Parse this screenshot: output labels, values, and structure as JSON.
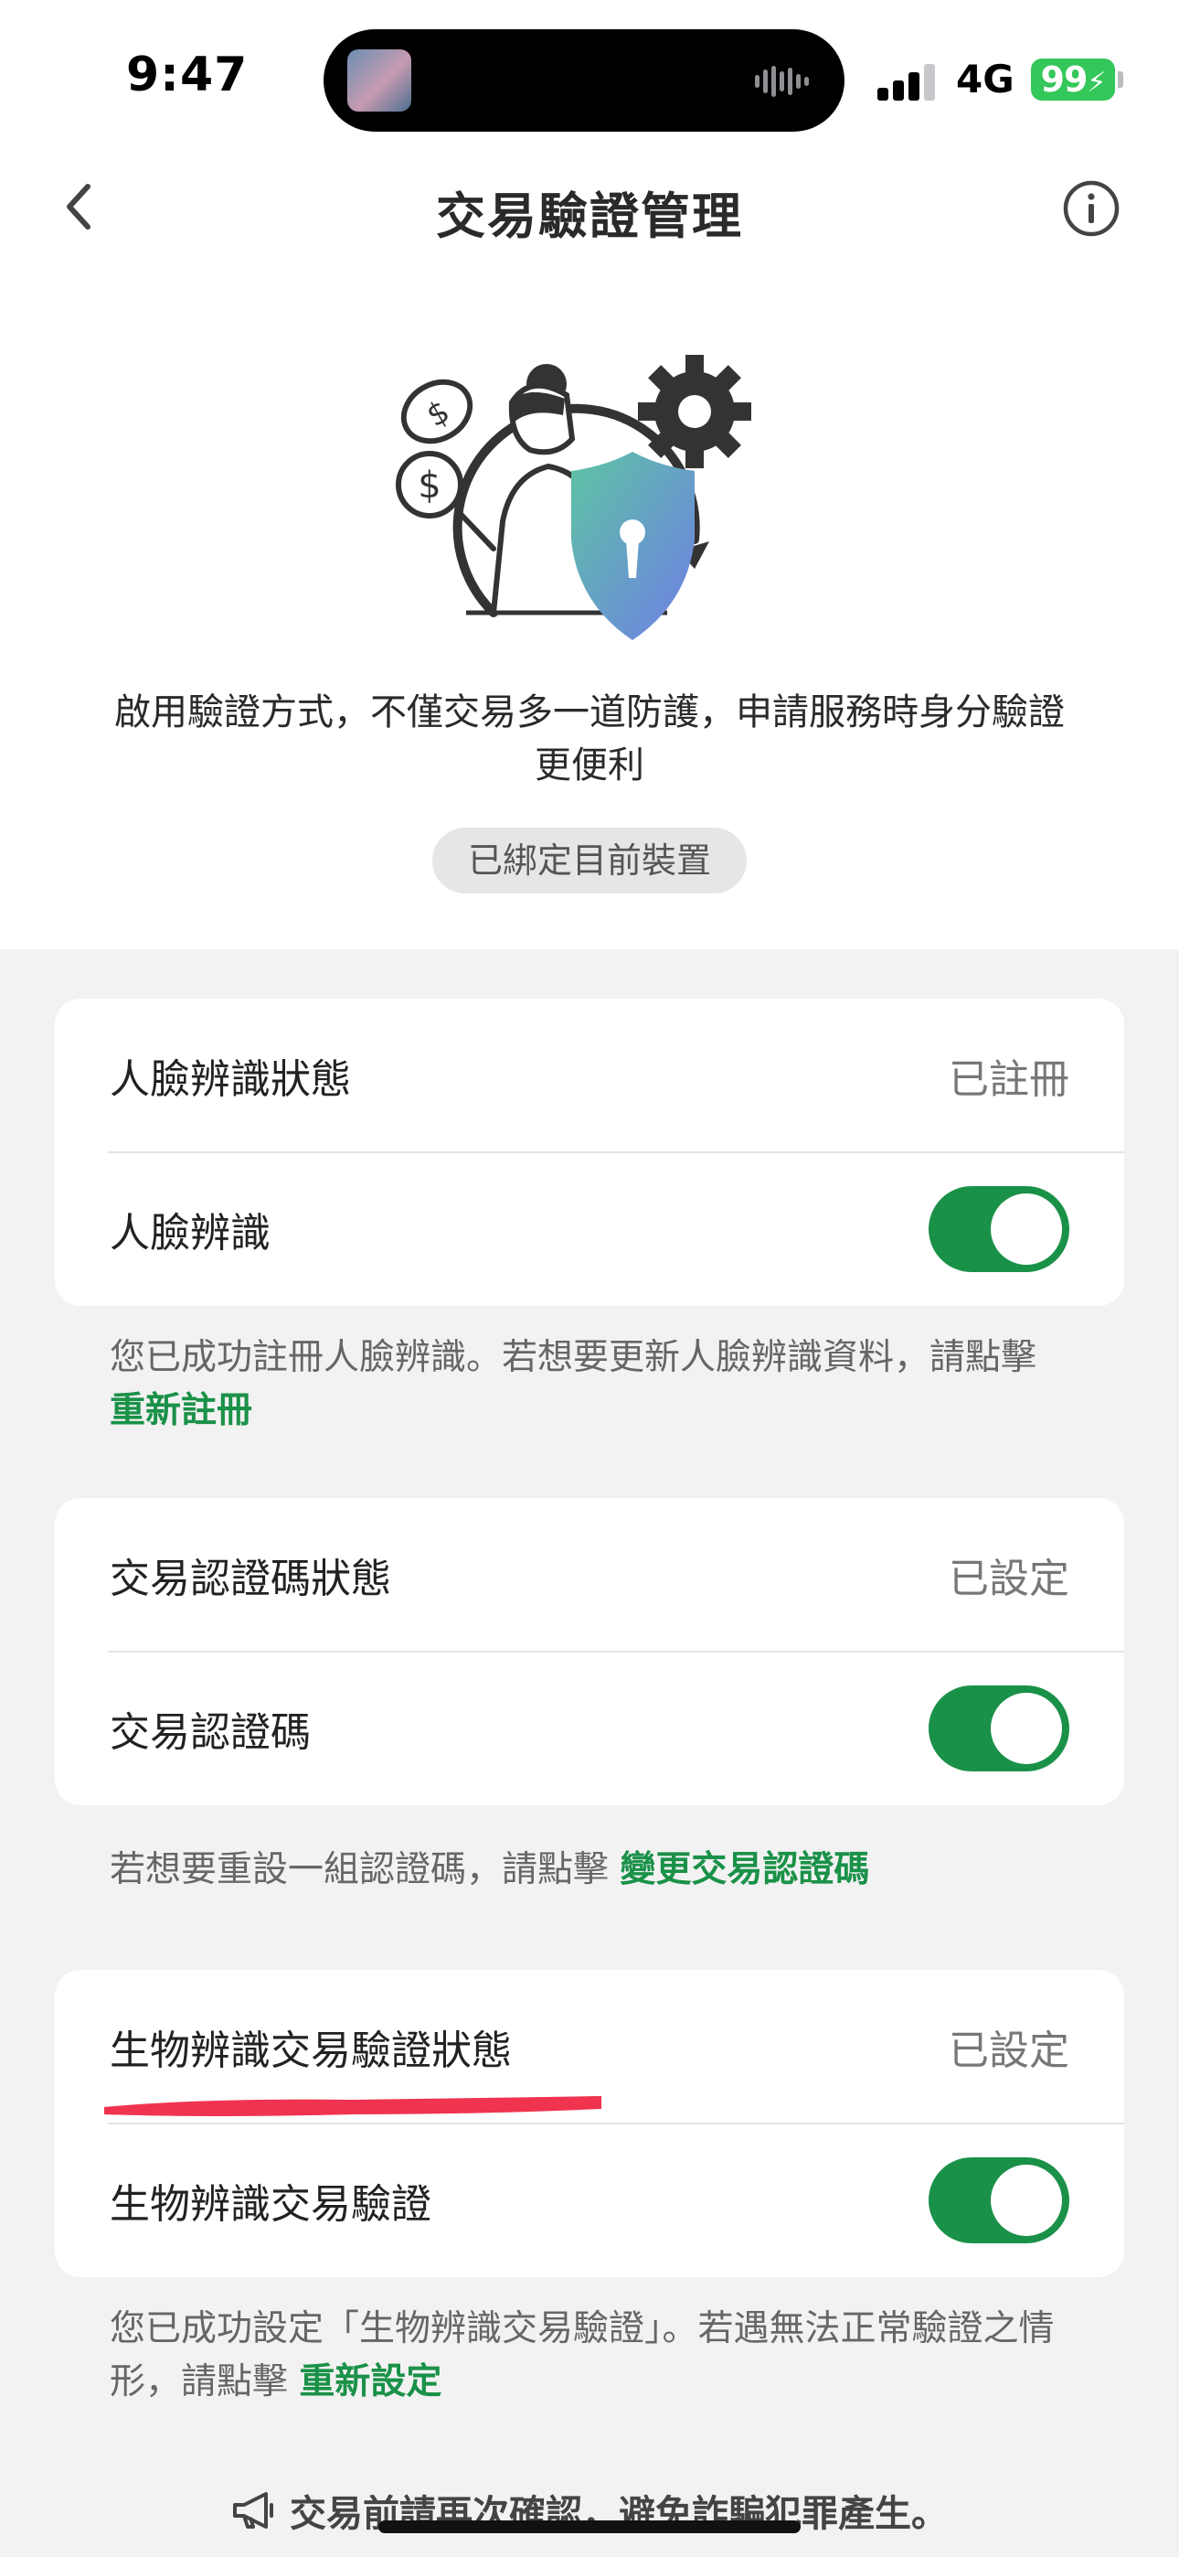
{
  "status_bar": {
    "time": "9:47",
    "network": "4G",
    "battery": "99"
  },
  "nav": {
    "title": "交易驗證管理",
    "back_icon": "chevron-left-icon",
    "info_icon": "info-circle-icon"
  },
  "hero": {
    "description_line1": "啟用驗證方式，不僅交易多一道防護，申請服務時身分驗證",
    "description_line2": "更便利",
    "device_badge": "已綁定目前裝置"
  },
  "face": {
    "status_label": "人臉辨識狀態",
    "status_value": "已註冊",
    "toggle_label": "人臉辨識",
    "toggle_on": true,
    "note_prefix": "您已成功註冊人臉辨識。若想要更新人臉辨識資料，請點擊",
    "note_link": "重新註冊"
  },
  "passcode": {
    "status_label": "交易認證碼狀態",
    "status_value": "已設定",
    "toggle_label": "交易認證碼",
    "toggle_on": true,
    "note_prefix": "若想要重設一組認證碼，請點擊",
    "note_link": "變更交易認證碼"
  },
  "biometric": {
    "status_label": "生物辨識交易驗證狀態",
    "status_value": "已設定",
    "toggle_label": "生物辨識交易驗證",
    "toggle_on": true,
    "note_prefix": "您已成功設定「生物辨識交易驗證」。若遇無法正常驗證之情形，請點擊",
    "note_link": "重新設定"
  },
  "footer": {
    "text": "交易前請再次確認，避免詐騙犯罪產生。",
    "icon": "megaphone-icon"
  },
  "colors": {
    "accent_green": "#1a9148",
    "battery_green": "#34c759",
    "annotation_red": "#f0334f"
  }
}
